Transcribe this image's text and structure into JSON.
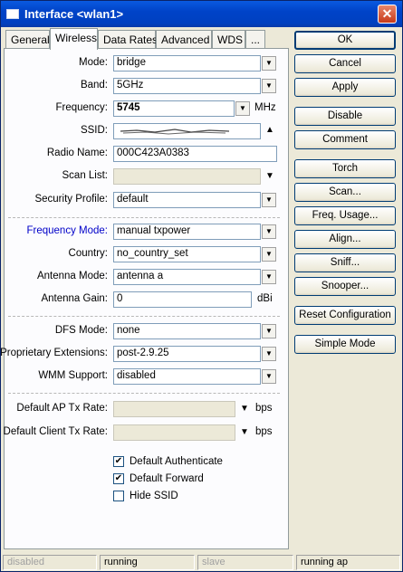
{
  "window": {
    "title": "Interface <wlan1>",
    "close_glyph": "✕"
  },
  "tabs": [
    "General",
    "Wireless",
    "Data Rates",
    "Advanced",
    "WDS",
    "..."
  ],
  "fields": {
    "mode": {
      "label": "Mode:",
      "value": "bridge"
    },
    "band": {
      "label": "Band:",
      "value": "5GHz"
    },
    "frequency": {
      "label": "Frequency:",
      "value": "5745",
      "unit": "MHz"
    },
    "ssid": {
      "label": "SSID:",
      "value": ""
    },
    "radio_name": {
      "label": "Radio Name:",
      "value": "000C423A0383"
    },
    "scan_list": {
      "label": "Scan List:",
      "value": ""
    },
    "security_profile": {
      "label": "Security Profile:",
      "value": "default"
    },
    "frequency_mode": {
      "label": "Frequency Mode:",
      "value": "manual txpower"
    },
    "country": {
      "label": "Country:",
      "value": "no_country_set"
    },
    "antenna_mode": {
      "label": "Antenna Mode:",
      "value": "antenna a"
    },
    "antenna_gain": {
      "label": "Antenna Gain:",
      "value": "0",
      "unit": "dBi"
    },
    "dfs_mode": {
      "label": "DFS Mode:",
      "value": "none"
    },
    "proprietary_extensions": {
      "label": "Proprietary Extensions:",
      "value": "post-2.9.25"
    },
    "wmm_support": {
      "label": "WMM Support:",
      "value": "disabled"
    },
    "default_ap_tx_rate": {
      "label": "Default AP Tx Rate:",
      "value": "",
      "unit": "bps"
    },
    "default_client_tx_rate": {
      "label": "Default Client Tx Rate:",
      "value": "",
      "unit": "bps"
    }
  },
  "checkboxes": {
    "default_authenticate": {
      "label": "Default Authenticate",
      "checked": true
    },
    "default_forward": {
      "label": "Default Forward",
      "checked": true
    },
    "hide_ssid": {
      "label": "Hide SSID",
      "checked": false
    }
  },
  "check_glyph": "✔",
  "buttons": [
    "OK",
    "Cancel",
    "Apply",
    "Disable",
    "Comment",
    "Torch",
    "Scan...",
    "Freq. Usage...",
    "Align...",
    "Sniff...",
    "Snooper...",
    "Reset Configuration",
    "Simple Mode"
  ],
  "status": [
    "disabled",
    "running",
    "slave",
    "running ap"
  ],
  "colors": {
    "titlebar": "#0043c8",
    "frequency_mode_label": "#0000c8",
    "face": "#ece9d8"
  }
}
